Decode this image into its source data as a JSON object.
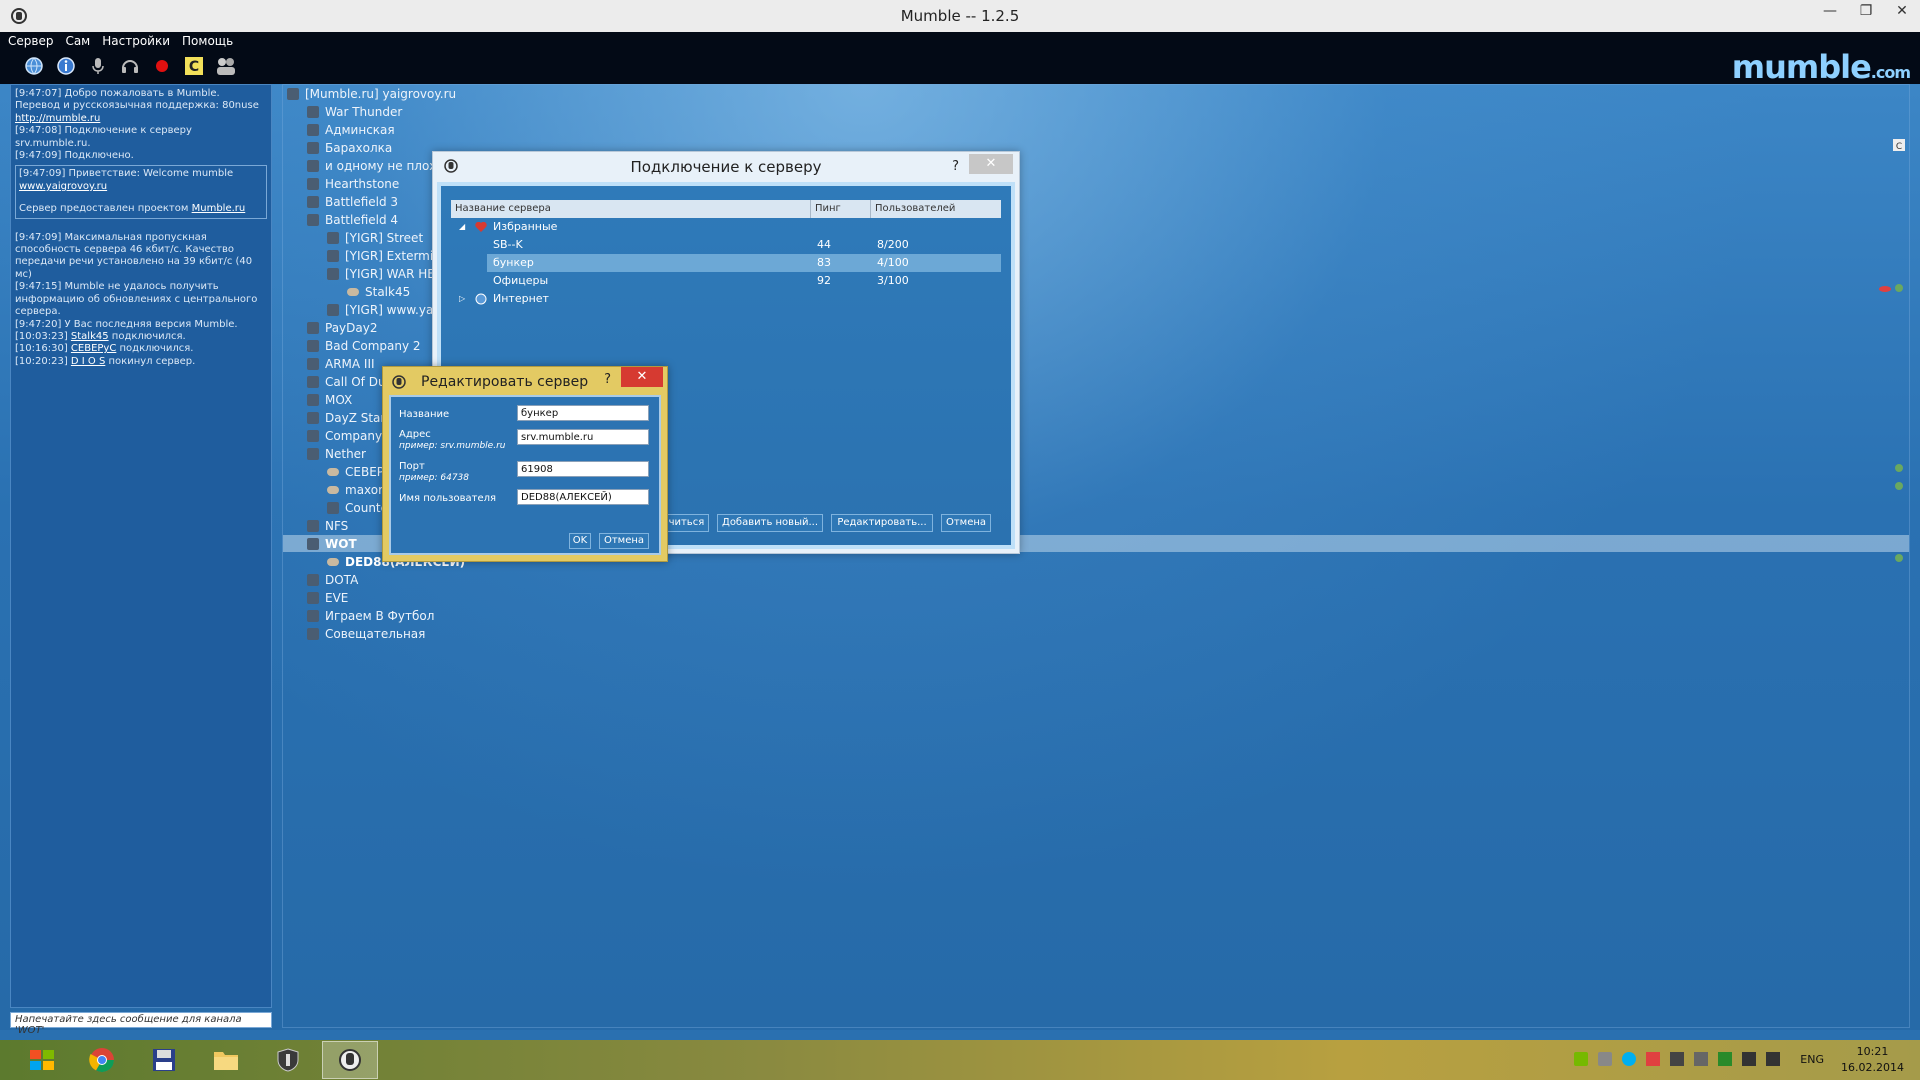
{
  "window": {
    "title": "Mumble -- 1.2.5",
    "minimize": "—",
    "maximize": "❐",
    "close": "✕"
  },
  "menu": [
    "Сервер",
    "Сам",
    "Настройки",
    "Помощь"
  ],
  "brand": {
    "main": "mumble",
    "suffix": ".com"
  },
  "log": {
    "lines": [
      {
        "t": "[9:47:07] Добро пожаловать в Mumble. Перевод и русскоязычная поддержка: 80nuse"
      },
      {
        "t": "http://mumble.ru",
        "link": true
      },
      {
        "t": "[9:47:08] Подключение к серверу srv.mumble.ru."
      },
      {
        "t": "[9:47:09] Подключено."
      }
    ],
    "box": [
      {
        "t": "[9:47:09] Приветствие: Welcome mumble"
      },
      {
        "t": "www.yaigrovoy.ru",
        "link": true
      },
      {
        "t": ""
      },
      {
        "t": "Сервер предоставлен проектом"
      },
      {
        "t": "Mumble.ru",
        "link": true
      }
    ],
    "lines2": [
      {
        "t": "[9:47:09] Максимальная пропускная способность сервера 46 кбит/с. Качество передачи речи установлено на 39 кбит/с (40 мс)"
      },
      {
        "t": "[9:47:15] Mumble не удалось получить информацию об обновлениях с центрального сервера."
      },
      {
        "t": "[9:47:20] У Вас последняя версия Mumble."
      },
      {
        "t": "[10:03:23]",
        "u": "Stalk45",
        "r": "подключился."
      },
      {
        "t": "[10:16:30]",
        "u": "CEBEPyC",
        "r": "подключился."
      },
      {
        "t": "[10:20:23]",
        "u": "D I O S",
        "r": "покинул сервер."
      }
    ],
    "input_placeholder": "Напечатайте здесь сообщение для канала 'WOT'"
  },
  "tree": [
    {
      "label": "[Mumble.ru] yaigrovoy.ru",
      "indent": 0,
      "kind": "chan"
    },
    {
      "label": "War Thunder",
      "indent": 1,
      "kind": "chan"
    },
    {
      "label": "Админская",
      "indent": 1,
      "kind": "chan"
    },
    {
      "label": "Барахолка",
      "indent": 1,
      "kind": "chan"
    },
    {
      "label": "и одному не плохо",
      "indent": 1,
      "kind": "chan"
    },
    {
      "label": " Hearthstone",
      "indent": 1,
      "kind": "chan"
    },
    {
      "label": "Battlefield 3",
      "indent": 1,
      "kind": "chan"
    },
    {
      "label": "Battlefield 4",
      "indent": 1,
      "kind": "chan"
    },
    {
      "label": "[YIGR] Street",
      "indent": 2,
      "kind": "chan"
    },
    {
      "label": "[YIGR] Extermi",
      "indent": 2,
      "kind": "chan"
    },
    {
      "label": "[YIGR] WAR HE",
      "indent": 2,
      "kind": "chan"
    },
    {
      "label": "Stalk45",
      "indent": 3,
      "kind": "user"
    },
    {
      "label": "[YIGR] www.ya",
      "indent": 2,
      "kind": "chan"
    },
    {
      "label": "PayDay2",
      "indent": 1,
      "kind": "chan"
    },
    {
      "label": "Bad Company 2",
      "indent": 1,
      "kind": "chan"
    },
    {
      "label": "ARMA III",
      "indent": 1,
      "kind": "chan"
    },
    {
      "label": "Call Of Dut",
      "indent": 1,
      "kind": "chan"
    },
    {
      "label": "MOX",
      "indent": 1,
      "kind": "chan"
    },
    {
      "label": "DayZ Stan",
      "indent": 1,
      "kind": "chan"
    },
    {
      "label": "Company (",
      "indent": 1,
      "kind": "chan"
    },
    {
      "label": "Nether",
      "indent": 1,
      "kind": "chan"
    },
    {
      "label": "CEBEP",
      "indent": 2,
      "kind": "user"
    },
    {
      "label": "maxor",
      "indent": 2,
      "kind": "user"
    },
    {
      "label": "Counte",
      "indent": 2,
      "kind": "chan"
    },
    {
      "label": "NFS",
      "indent": 1,
      "kind": "chan"
    },
    {
      "label": "WOT",
      "indent": 1,
      "kind": "chan",
      "bold": true
    },
    {
      "label": "DED88(АЛЕКСЕЙ)",
      "indent": 2,
      "kind": "user",
      "bold": true
    },
    {
      "label": "DOTA",
      "indent": 1,
      "kind": "chan"
    },
    {
      "label": "EVE",
      "indent": 1,
      "kind": "chan"
    },
    {
      "label": "Играем В Футбол",
      "indent": 1,
      "kind": "chan"
    },
    {
      "label": "Совещательная",
      "indent": 1,
      "kind": "chan"
    }
  ],
  "connect_dialog": {
    "title": "Подключение к серверу",
    "help": "?",
    "close": "✕",
    "columns": [
      "Название сервера",
      "Пинг",
      "Пользователей"
    ],
    "groups": [
      {
        "label": "Избранные"
      },
      {
        "label": "Интернет"
      }
    ],
    "servers": [
      {
        "name": "SB--K",
        "ping": "44",
        "users": "8/200"
      },
      {
        "name": "бункер",
        "ping": "83",
        "users": "4/100",
        "selected": true
      },
      {
        "name": "Офицеры",
        "ping": "92",
        "users": "3/100"
      }
    ],
    "buttons": {
      "connect": "лючиться",
      "add": "Добавить новый...",
      "edit": "Редактировать...",
      "cancel": "Отмена"
    }
  },
  "edit_dialog": {
    "title": "Редактировать сервер",
    "help": "?",
    "close": "✕",
    "fields": {
      "name_label": "Название",
      "name_value": "бункер",
      "address_label": "Адрес",
      "address_hint": "пример: srv.mumble.ru",
      "address_value": "srv.mumble.ru",
      "port_label": "Порт",
      "port_hint": "пример: 64738",
      "port_value": "61908",
      "user_label": "Имя пользователя",
      "user_value": "DED88(АЛЕКСЕЙ)"
    },
    "ok": "OK",
    "cancel": "Отмена"
  },
  "taskbar": {
    "lang": "ENG",
    "time": "10:21",
    "date": "16.02.2014"
  },
  "colors": {
    "accent": "#2a71b2",
    "edit_frame": "#e3ca63",
    "close_red": "#d63a31"
  }
}
